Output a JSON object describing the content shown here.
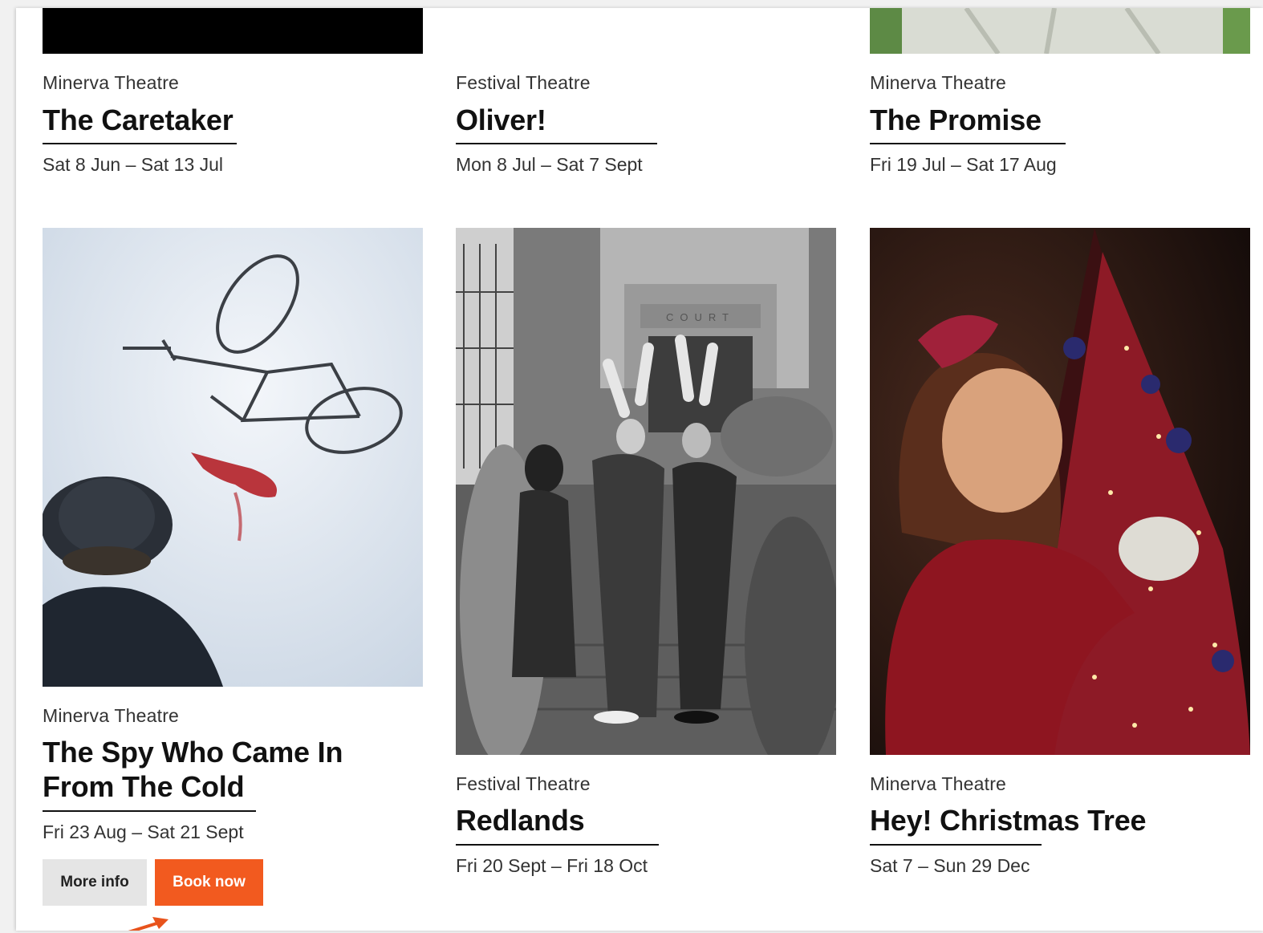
{
  "shows": [
    {
      "venue": "Minerva Theatre",
      "title": "The Caretaker",
      "dates": "Sat 8 Jun – Sat 13 Jul"
    },
    {
      "venue": "Festival Theatre",
      "title": "Oliver!",
      "dates": "Mon 8 Jul – Sat 7 Sept"
    },
    {
      "venue": "Minerva Theatre",
      "title": "The Promise",
      "dates": "Fri 19 Jul – Sat 17 Aug"
    },
    {
      "venue": "Minerva Theatre",
      "title_line1": "The Spy Who Came In",
      "title_line2": "From The Cold",
      "dates": "Fri 23 Aug – Sat 21 Sept",
      "more_info_label": "More info",
      "book_now_label": "Book now"
    },
    {
      "venue": "Festival Theatre",
      "title": "Redlands",
      "dates": "Fri 20 Sept – Fri 18 Oct",
      "court_sign": "COURT"
    },
    {
      "venue": "Minerva Theatre",
      "title": "Hey! Christmas Tree",
      "dates": "Sat 7 – Sun 29 Dec"
    }
  ],
  "colors": {
    "accent": "#f25a1f",
    "button_secondary": "#e5e5e5"
  }
}
